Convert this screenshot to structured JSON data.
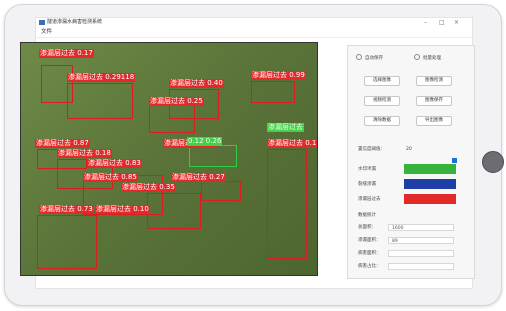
{
  "app": {
    "title": "隧道渗漏水病害检测系统",
    "menu": "文件",
    "controls": [
      "–",
      "□",
      "×"
    ]
  },
  "detections": [
    {
      "label": "渗漏层过去 0.17",
      "color": "red"
    },
    {
      "label": "渗漏层过去 0.29118",
      "color": "red"
    },
    {
      "label": "渗漏层过去 0.40",
      "color": "red"
    },
    {
      "label": "渗漏层过去 0.25",
      "color": "red"
    },
    {
      "label": "渗漏层过去 0.99",
      "color": "red"
    },
    {
      "label": "渗漏层过去 0.87",
      "color": "red"
    },
    {
      "label": "渗漏层过去 0.37",
      "color": "red"
    },
    {
      "label": "渗漏层过去 0.18",
      "color": "red"
    },
    {
      "label": "渗漏层过去 0.83",
      "color": "red"
    },
    {
      "label": "渗漏层过去 0.85",
      "color": "red"
    },
    {
      "label": "渗漏层过去 0.27",
      "color": "red"
    },
    {
      "label": "渗漏层过去 0.35",
      "color": "red"
    },
    {
      "label": "渗漏层过去 0.73",
      "color": "red"
    },
    {
      "label": "渗漏层过去 0.10",
      "color": "red"
    },
    {
      "label": "渗漏层过去 0.17",
      "color": "red"
    },
    {
      "label": "0.12 0.26",
      "color": "green"
    },
    {
      "label": "渗漏层过去",
      "color": "green"
    }
  ],
  "sidebar": {
    "radio_auto": "自动保存",
    "radio_batch": "批量处理",
    "buttons": {
      "select_image": "选择图像",
      "image_detect": "图像检测",
      "video_detect": "视频检测",
      "image_save": "图像保存",
      "clear_data": "清除数据",
      "export_image": "导出图像"
    },
    "threshold_label": "置信度阈值：",
    "threshold_value": "20",
    "legend": [
      {
        "label": "水印滲漏",
        "color": "#35b33a"
      },
      {
        "label": "裂缝渗漏",
        "color": "#1f3fa8"
      },
      {
        "label": "渗漏层过去",
        "color": "#e22a2a"
      }
    ],
    "stats_title": "数据统计",
    "stats": [
      {
        "label": "总面积：",
        "value": "1600"
      },
      {
        "label": "渗漏面积：",
        "value": "89"
      },
      {
        "label": "病害面积：",
        "value": ""
      },
      {
        "label": "病害占比：",
        "value": ""
      }
    ]
  }
}
